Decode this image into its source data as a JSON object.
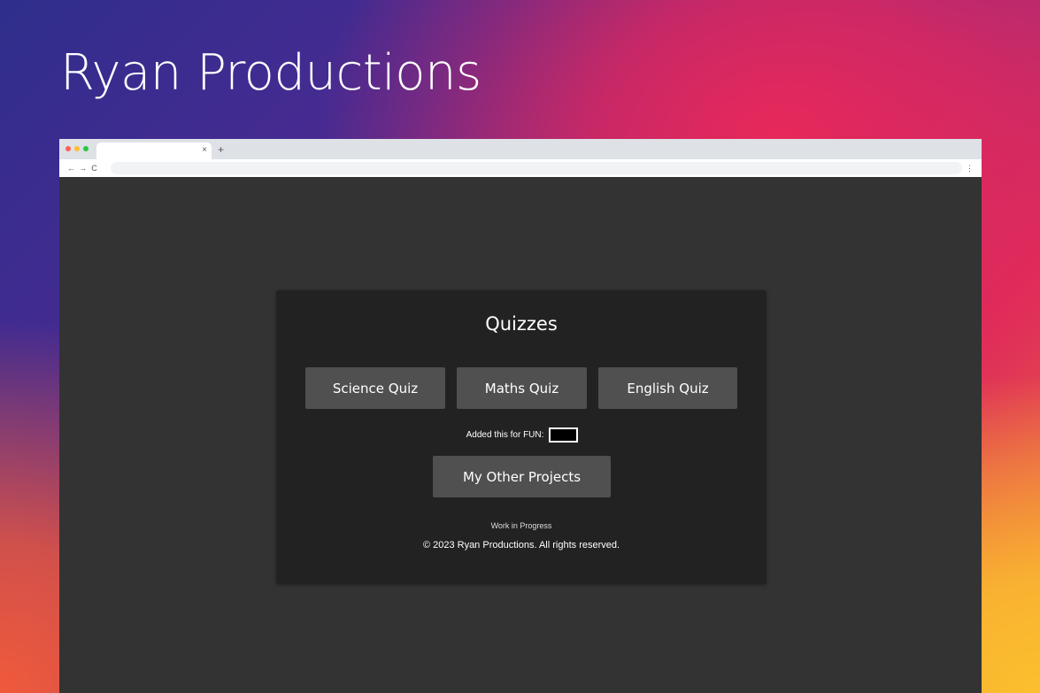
{
  "page": {
    "hero_title": "Ryan Productions"
  },
  "browser": {
    "tab_close_glyph": "×",
    "new_tab_glyph": "+",
    "back_glyph": "←",
    "forward_glyph": "→",
    "reload_glyph": "C",
    "menu_glyph": "⋮",
    "traffic_lights": [
      "#fe5f57",
      "#febc2e",
      "#28c840"
    ]
  },
  "site": {
    "heading": "Quizzes",
    "quiz_buttons": [
      {
        "label": "Science Quiz"
      },
      {
        "label": "Maths Quiz"
      },
      {
        "label": "English Quiz"
      }
    ],
    "fun_label": "Added this for FUN:",
    "projects_button": "My Other Projects",
    "status_text": "Work in Progress",
    "footer": "© 2023 Ryan Productions. All rights reserved."
  },
  "colors": {
    "page_bg": "#333333",
    "card_bg": "#222222",
    "button_bg": "#505050",
    "text": "#ffffff"
  }
}
